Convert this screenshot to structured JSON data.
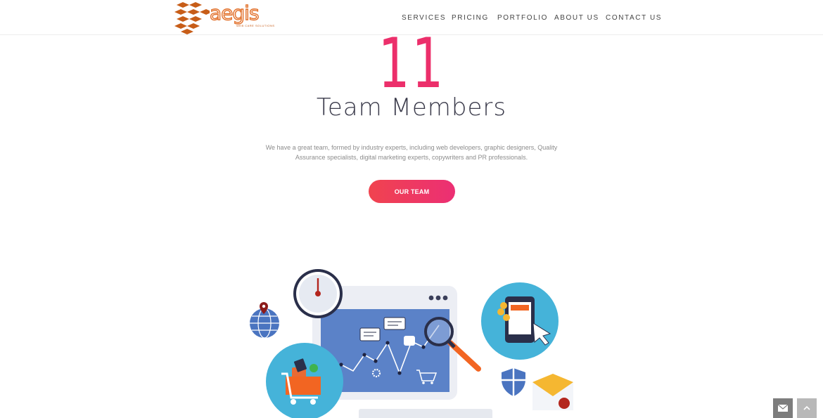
{
  "header": {
    "logo": {
      "name": "aegis",
      "tagline": "WEB CARE SOLUTIONS"
    },
    "nav": [
      {
        "label": "SERVICES"
      },
      {
        "label": "PRICING"
      },
      {
        "label": "PORTFOLIO"
      },
      {
        "label": "ABOUT US"
      },
      {
        "label": "CONTACT US"
      }
    ]
  },
  "stat": {
    "number": "11",
    "title": "Team Members",
    "description": "We have a great team, formed by industry experts, including web developers, graphic designers, Quality Assurance specialists, digital marketing experts, copywriters and PR professionals.",
    "button_label": "OUR TEAM"
  },
  "colors": {
    "accent": "#ec2f6b",
    "button_gradient_start": "#f0434f",
    "button_gradient_end": "#ec2f74",
    "logo_orange": "#e2702a",
    "illustration_blue": "#4a74c0",
    "illustration_cyan": "#3aaed4"
  },
  "icons": {
    "mail": "envelope-icon",
    "scroll_top": "chevron-up-icon"
  }
}
